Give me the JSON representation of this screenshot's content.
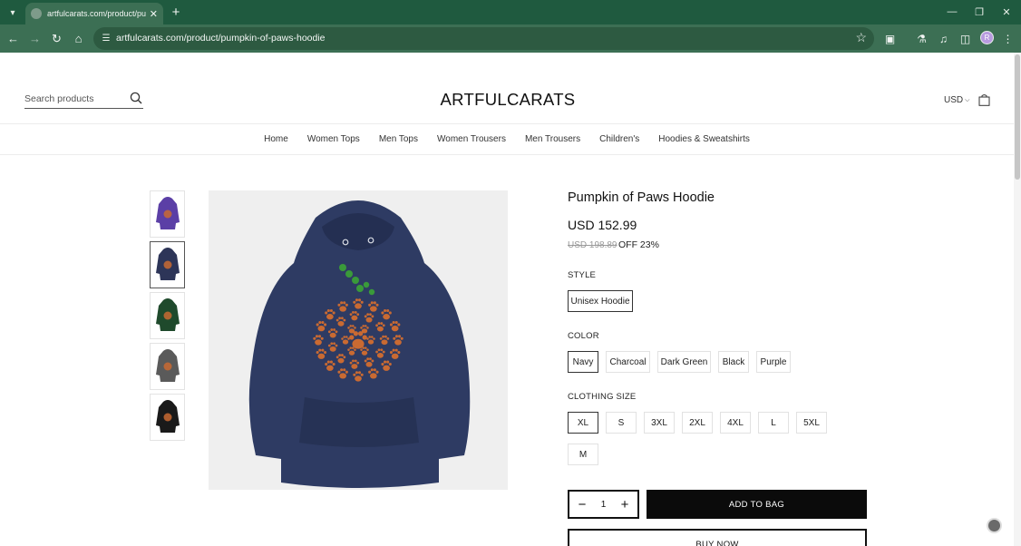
{
  "browser": {
    "tab_title": "artfulcarats.com/product/pumpkin",
    "url": "artfulcarats.com/product/pumpkin-of-paws-hoodie",
    "profile_initial": "R"
  },
  "header": {
    "search_placeholder": "Search products",
    "logo": "ARTFULCARATS",
    "currency": "USD"
  },
  "nav": [
    "Home",
    "Women Tops",
    "Men Tops",
    "Women Trousers",
    "Men Trousers",
    "Children's",
    "Hoodies & Sweatshirts"
  ],
  "gallery": {
    "thumbnails": [
      {
        "color": "Purple",
        "fill": "#5b3fa6"
      },
      {
        "color": "Navy",
        "fill": "#2d3558"
      },
      {
        "color": "Dark Green",
        "fill": "#1f4a2c"
      },
      {
        "color": "Charcoal",
        "fill": "#5a5a5a"
      },
      {
        "color": "Black",
        "fill": "#1a1a1a"
      }
    ],
    "selected_index": 1,
    "main_color": "#2e3b63",
    "print_color": "#c96a32"
  },
  "product": {
    "title": "Pumpkin of Paws Hoodie",
    "price": "USD 152.99",
    "old_price": "USD 198.89",
    "discount": "OFF 23%",
    "style_label": "STYLE",
    "styles": [
      "Unisex Hoodie"
    ],
    "color_label": "COLOR",
    "colors": [
      "Navy",
      "Charcoal",
      "Dark Green",
      "Black",
      "Purple"
    ],
    "selected_color": "Navy",
    "size_label": "CLOTHING SIZE",
    "sizes": [
      "XL",
      "S",
      "3XL",
      "2XL",
      "4XL",
      "L",
      "5XL",
      "M"
    ],
    "selected_size": "XL",
    "quantity": "1",
    "add_to_bag": "ADD TO BAG",
    "buy_now": "BUY NOW"
  }
}
